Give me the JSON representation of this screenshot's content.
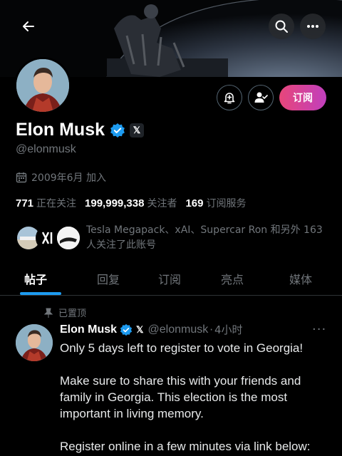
{
  "profile": {
    "display_name": "Elon Musk",
    "handle": "@elonmusk",
    "joined": "2009年6月 加入",
    "subscribe_label": "订阅"
  },
  "stats": {
    "following_count": "771",
    "following_label": "正在关注",
    "followers_count": "199,999,338",
    "followers_label": "关注者",
    "subscriptions_count": "169",
    "subscriptions_label": "订阅服务"
  },
  "followed_by": {
    "text": "Tesla Megapack、xAI、Supercar Ron 和另外 163 人关注了此账号"
  },
  "tabs": [
    {
      "label": "帖子",
      "active": true
    },
    {
      "label": "回复",
      "active": false
    },
    {
      "label": "订阅",
      "active": false
    },
    {
      "label": "亮点",
      "active": false
    },
    {
      "label": "媒体",
      "active": false
    }
  ],
  "post": {
    "pinned_label": "已置顶",
    "author": "Elon Musk",
    "handle": "@elonmusk",
    "time": "4小时",
    "paragraphs": [
      "Only 5 days left to register to vote in Georgia!",
      "Make sure to share this with your friends and family in Georgia. This election is the most important in living memory.",
      "Register online in a few minutes via link below:"
    ]
  },
  "icons": {
    "back": "arrow-left-icon",
    "search": "search-icon",
    "more": "more-horizontal-icon",
    "notify": "bell-plus-icon",
    "following": "person-check-icon",
    "verified": "verified-badge-icon",
    "x_logo": "x-logo-icon",
    "calendar": "calendar-icon",
    "pin": "pin-icon"
  },
  "colors": {
    "accent": "#1d9bf0",
    "subscribe_gradient_start": "#e7467a",
    "subscribe_gradient_end": "#c13fbd",
    "muted": "#71767b",
    "background": "#000000"
  }
}
